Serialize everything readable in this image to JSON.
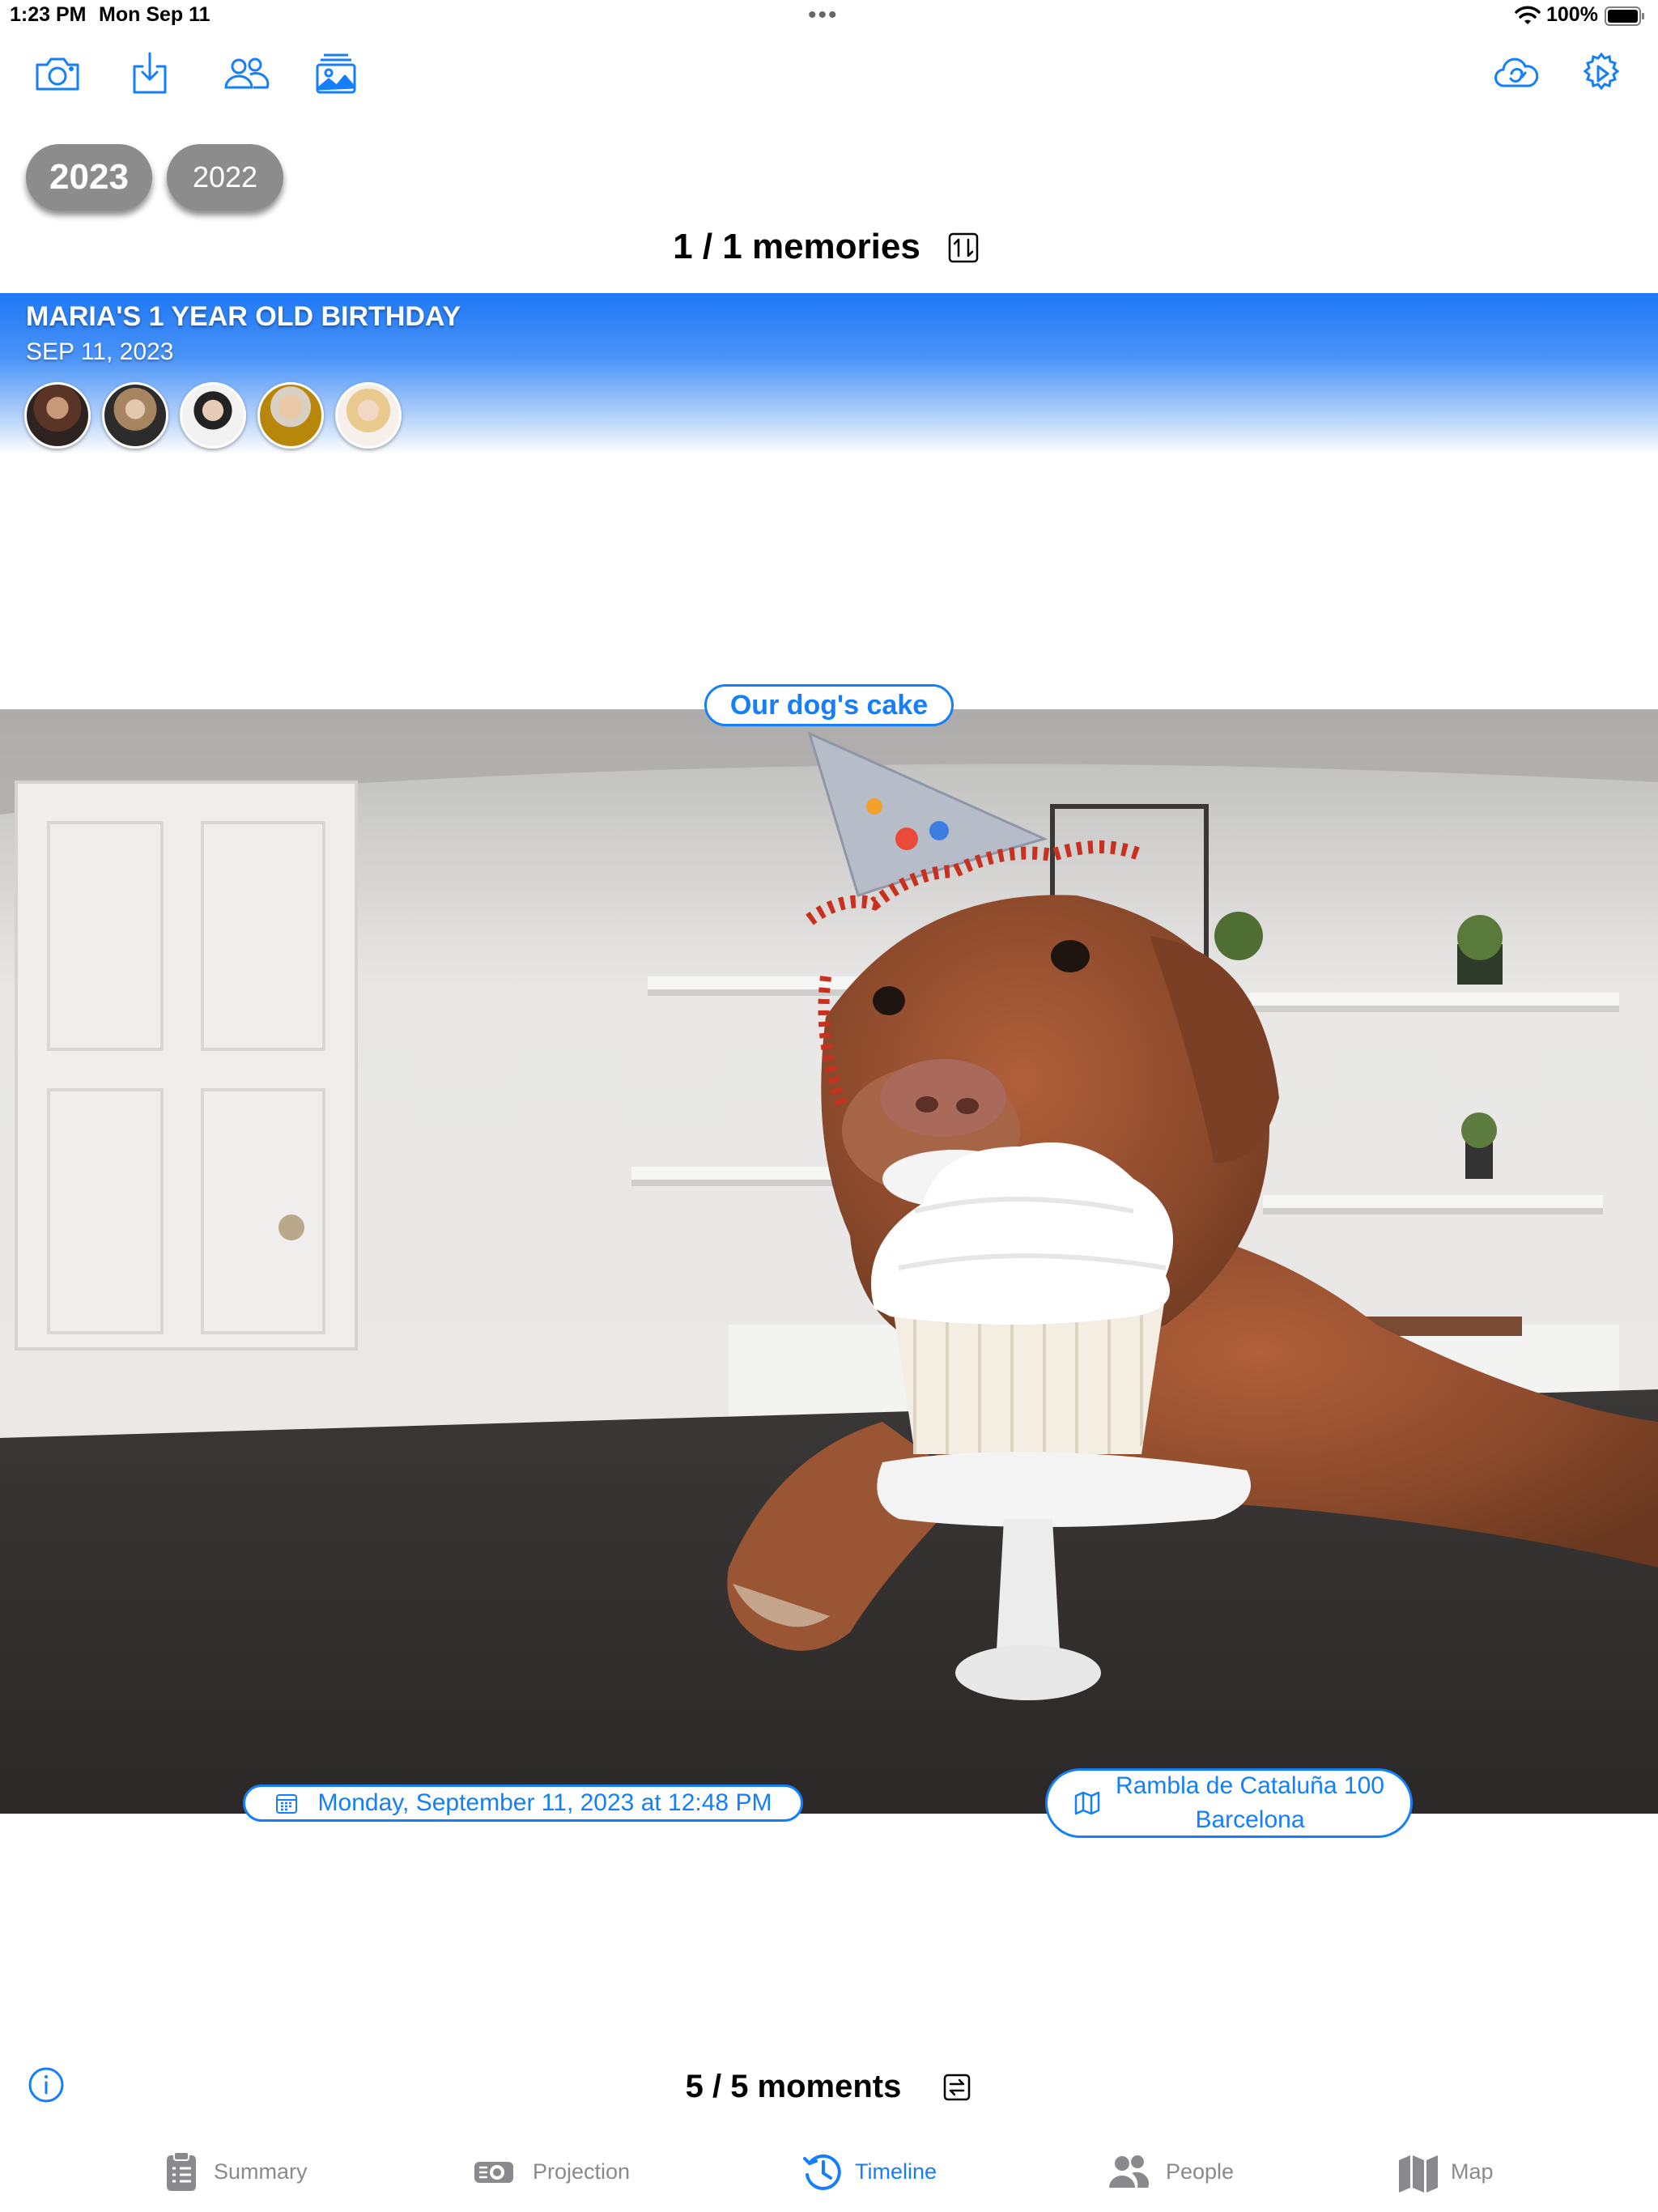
{
  "status": {
    "time": "1:23 PM",
    "date": "Mon Sep 11",
    "battery": "100%",
    "multitask": "•••"
  },
  "toolbar": {
    "icons": [
      "camera-icon",
      "import-icon",
      "people-icon",
      "gallery-icon",
      "cloud-sync-icon",
      "settings-icon"
    ]
  },
  "years": [
    "2023",
    "2022"
  ],
  "selected_year": "2023",
  "memories": {
    "count_label": "1 / 1 memories"
  },
  "memory": {
    "title": "MARIA'S 1 YEAR OLD BIRTHDAY",
    "date": "SEP 11, 2023",
    "avatar_count": 5
  },
  "moment": {
    "caption": "Our dog's cake",
    "datetime": "Monday, September 11, 2023 at 12:48 PM",
    "location_line1": "Rambla de Cataluña 100",
    "location_line2": "Barcelona"
  },
  "moments": {
    "count_label": "5 / 5 moments"
  },
  "tabs": [
    {
      "label": "Summary",
      "icon": "clipboard-icon"
    },
    {
      "label": "Projection",
      "icon": "projector-icon"
    },
    {
      "label": "Timeline",
      "icon": "clock-history-icon",
      "active": true
    },
    {
      "label": "People",
      "icon": "people-icon"
    },
    {
      "label": "Map",
      "icon": "map-icon"
    }
  ],
  "colors": {
    "accent": "#147EFB",
    "pill": "#8c8c8c",
    "tab_inactive": "#8a8a8e"
  }
}
